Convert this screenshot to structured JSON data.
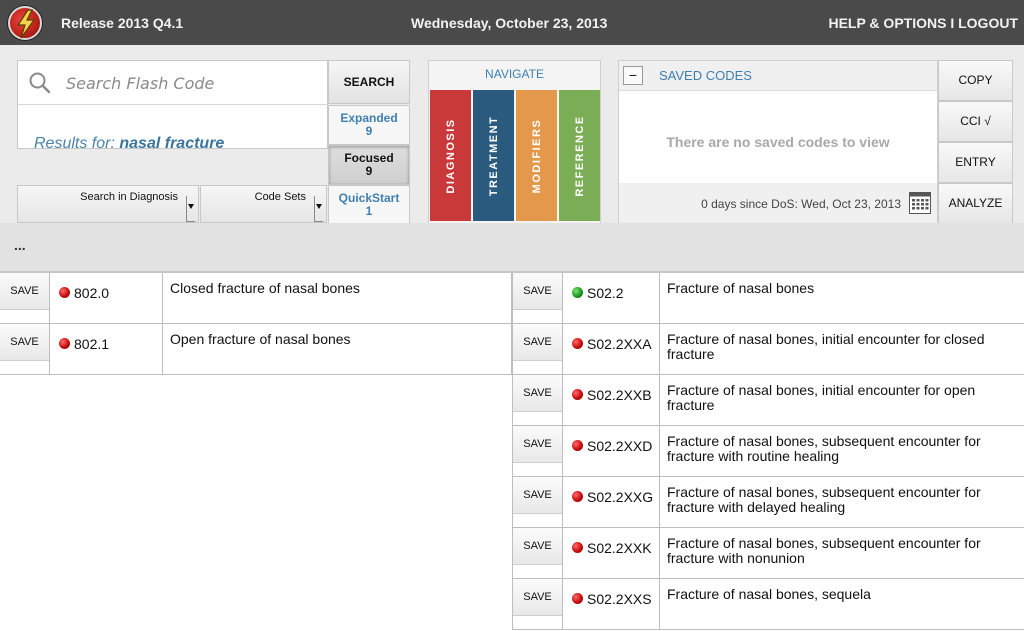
{
  "topbar": {
    "release": "Release 2013 Q4.1",
    "date": "Wednesday, October 23, 2013",
    "help": "HELP & OPTIONS",
    "separator": "I",
    "logout": "LOGOUT"
  },
  "search": {
    "placeholder": "Search Flash Code",
    "button": "SEARCH",
    "results_prefix": "Results for:",
    "results_term": "nasal fracture"
  },
  "scopes": [
    {
      "label": "Expanded",
      "count": "9",
      "active": false
    },
    {
      "label": "Focused",
      "count": "9",
      "active": true
    },
    {
      "label": "QuickStart",
      "count": "1",
      "active": false
    }
  ],
  "dropdowns": {
    "search_in": "Search in Diagnosis",
    "code_sets": "Code Sets"
  },
  "navigate": {
    "title": "NAVIGATE",
    "tabs": [
      {
        "label": "DIAGNOSIS",
        "color": "#c9393a"
      },
      {
        "label": "TREATMENT",
        "color": "#2a5b7f"
      },
      {
        "label": "MODIFIERS",
        "color": "#e3984b"
      },
      {
        "label": "REFERENCE",
        "color": "#7aad55"
      }
    ]
  },
  "saved": {
    "collapse": "−",
    "title": "SAVED CODES",
    "empty": "There are no saved codes to view",
    "dos": "0 days since DoS: Wed, Oct 23, 2013"
  },
  "actions": [
    "COPY",
    "CCI √",
    "ENTRY",
    "ANALYZE"
  ],
  "toolbar": {
    "ellipsis": "..."
  },
  "save_label": "SAVE",
  "left_codes": [
    {
      "code": "802.0",
      "status": "red",
      "desc": "Closed fracture of nasal bones"
    },
    {
      "code": "802.1",
      "status": "red",
      "desc": "Open fracture of nasal bones"
    }
  ],
  "right_codes": [
    {
      "code": "S02.2",
      "status": "green",
      "desc": "Fracture of nasal bones"
    },
    {
      "code": "S02.2XXA",
      "status": "red",
      "desc": "Fracture of nasal bones, initial encounter for closed fracture"
    },
    {
      "code": "S02.2XXB",
      "status": "red",
      "desc": "Fracture of nasal bones, initial encounter for open fracture"
    },
    {
      "code": "S02.2XXD",
      "status": "red",
      "desc": "Fracture of nasal bones, subsequent encounter for fracture with routine healing"
    },
    {
      "code": "S02.2XXG",
      "status": "red",
      "desc": "Fracture of nasal bones, subsequent encounter for fracture with delayed healing"
    },
    {
      "code": "S02.2XXK",
      "status": "red",
      "desc": "Fracture of nasal bones, subsequent encounter for fracture with nonunion"
    },
    {
      "code": "S02.2XXS",
      "status": "red",
      "desc": "Fracture of nasal bones, sequela"
    }
  ]
}
